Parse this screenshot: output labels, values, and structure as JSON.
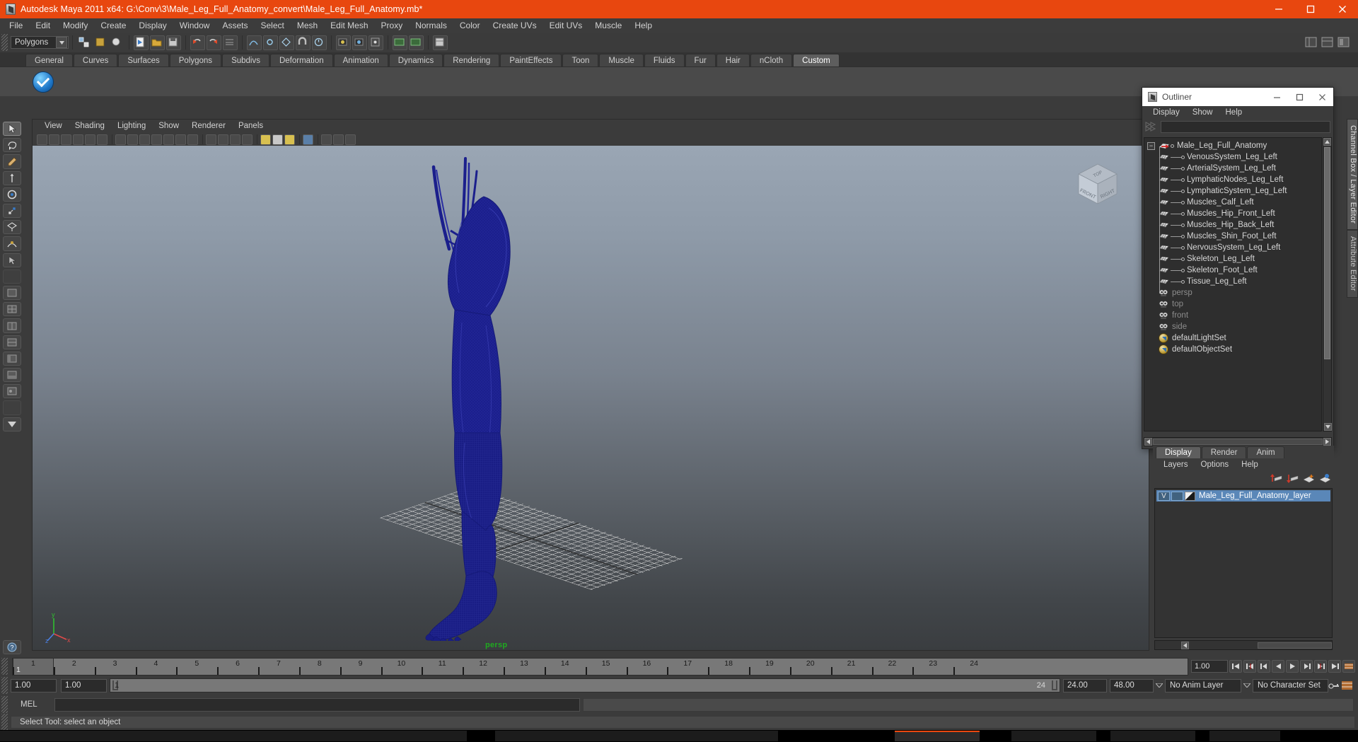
{
  "window": {
    "title": "Autodesk Maya 2011 x64: G:\\Conv\\3\\Male_Leg_Full_Anatomy_convert\\Male_Leg_Full_Anatomy.mb*",
    "accent_color": "#e8470f",
    "minimize": "─",
    "maximize": "□",
    "close": "✕"
  },
  "menubar": {
    "items": [
      {
        "label": "File"
      },
      {
        "label": "Edit"
      },
      {
        "label": "Modify"
      },
      {
        "label": "Create"
      },
      {
        "label": "Display"
      },
      {
        "label": "Window"
      },
      {
        "label": "Assets"
      },
      {
        "label": "Select"
      },
      {
        "label": "Mesh"
      },
      {
        "label": "Edit Mesh"
      },
      {
        "label": "Proxy"
      },
      {
        "label": "Normals"
      },
      {
        "label": "Color"
      },
      {
        "label": "Create UVs"
      },
      {
        "label": "Edit UVs"
      },
      {
        "label": "Muscle"
      },
      {
        "label": "Help"
      }
    ]
  },
  "statusline": {
    "mode_selected": "Polygons",
    "mode_arrow": "▼"
  },
  "shelf": {
    "tabs": [
      {
        "label": "General"
      },
      {
        "label": "Curves"
      },
      {
        "label": "Surfaces"
      },
      {
        "label": "Polygons"
      },
      {
        "label": "Subdivs"
      },
      {
        "label": "Deformation"
      },
      {
        "label": "Animation"
      },
      {
        "label": "Dynamics"
      },
      {
        "label": "Rendering"
      },
      {
        "label": "PaintEffects"
      },
      {
        "label": "Toon"
      },
      {
        "label": "Muscle"
      },
      {
        "label": "Fluids"
      },
      {
        "label": "Fur"
      },
      {
        "label": "Hair"
      },
      {
        "label": "nCloth"
      },
      {
        "label": "Custom"
      }
    ],
    "active_tab": "Custom"
  },
  "viewport": {
    "menu": [
      {
        "label": "View"
      },
      {
        "label": "Shading"
      },
      {
        "label": "Lighting"
      },
      {
        "label": "Show"
      },
      {
        "label": "Renderer"
      },
      {
        "label": "Panels"
      }
    ],
    "camera_label": "persp",
    "viewcube": {
      "top": "TOP",
      "front": "FRONT",
      "right": "RIGHT"
    },
    "axis": {
      "y": "y",
      "x": "x",
      "z": "z"
    },
    "model_color": "#1b1f8c",
    "background_top": "#9aa6b4",
    "background_bottom": "#3a3d40"
  },
  "outliner": {
    "title": "Outliner",
    "menu": [
      {
        "label": "Display"
      },
      {
        "label": "Show"
      },
      {
        "label": "Help"
      }
    ],
    "search_value": "",
    "items": [
      {
        "label": "Male_Leg_Full_Anatomy",
        "type": "group",
        "level": 0
      },
      {
        "label": "VenousSystem_Leg_Left",
        "type": "mesh",
        "level": 1
      },
      {
        "label": "ArterialSystem_Leg_Left",
        "type": "mesh",
        "level": 1
      },
      {
        "label": "LymphaticNodes_Leg_Left",
        "type": "mesh",
        "level": 1
      },
      {
        "label": "LymphaticSystem_Leg_Left",
        "type": "mesh",
        "level": 1
      },
      {
        "label": "Muscles_Calf_Left",
        "type": "mesh",
        "level": 1
      },
      {
        "label": "Muscles_Hip_Front_Left",
        "type": "mesh",
        "level": 1
      },
      {
        "label": "Muscles_Hip_Back_Left",
        "type": "mesh",
        "level": 1
      },
      {
        "label": "Muscles_Shin_Foot_Left",
        "type": "mesh",
        "level": 1
      },
      {
        "label": "NervousSystem_Leg_Left",
        "type": "mesh",
        "level": 1
      },
      {
        "label": "Skeleton_Leg_Left",
        "type": "mesh",
        "level": 1
      },
      {
        "label": "Skeleton_Foot_Left",
        "type": "mesh",
        "level": 1
      },
      {
        "label": "Tissue_Leg_Left",
        "type": "mesh",
        "level": 1
      },
      {
        "label": "persp",
        "type": "camera",
        "level": 0,
        "dim": true
      },
      {
        "label": "top",
        "type": "camera",
        "level": 0,
        "dim": true
      },
      {
        "label": "front",
        "type": "camera",
        "level": 0,
        "dim": true
      },
      {
        "label": "side",
        "type": "camera",
        "level": 0,
        "dim": true
      },
      {
        "label": "defaultLightSet",
        "type": "set",
        "level": 0
      },
      {
        "label": "defaultObjectSet",
        "type": "set",
        "level": 0
      }
    ]
  },
  "side_tabs": [
    {
      "label": "Channel Box / Layer Editor",
      "active": true
    },
    {
      "label": "Attribute Editor",
      "active": false
    }
  ],
  "layer_editor": {
    "tabs": [
      {
        "label": "Display",
        "active": true
      },
      {
        "label": "Render",
        "active": false
      },
      {
        "label": "Anim",
        "active": false
      }
    ],
    "menu": [
      {
        "label": "Layers"
      },
      {
        "label": "Options"
      },
      {
        "label": "Help"
      }
    ],
    "layers": [
      {
        "visibility": "V",
        "playback": "",
        "name": "Male_Leg_Full_Anatomy_layer",
        "selected": true
      }
    ]
  },
  "timeline": {
    "frames": [
      1,
      2,
      3,
      4,
      5,
      6,
      7,
      8,
      9,
      10,
      11,
      12,
      13,
      14,
      15,
      16,
      17,
      18,
      19,
      20,
      21,
      22,
      23,
      24
    ],
    "current_frame": "1",
    "current_frame_field": "1.00",
    "range_start_field": "1.00",
    "range_end_field": "1.00",
    "range_bar_start": "1",
    "range_bar_end": "24",
    "anim_start": "24.00",
    "anim_end": "48.00",
    "anim_layer": "No Anim Layer",
    "character_set": "No Character Set"
  },
  "command": {
    "mel_label": "MEL",
    "mel_value": "",
    "help_text": "Select Tool: select an object"
  }
}
